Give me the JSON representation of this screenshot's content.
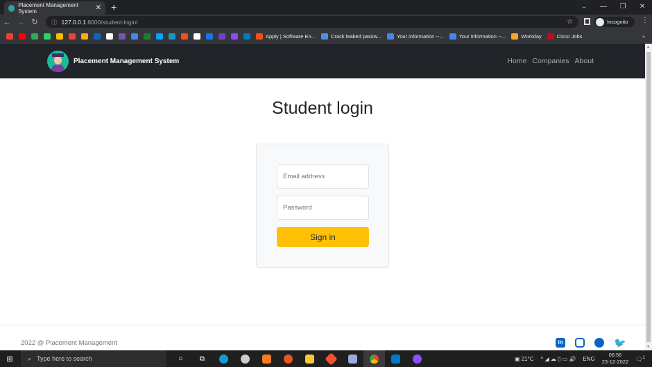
{
  "browser": {
    "tab_title": "Placement Management System",
    "url_host": "127.0.0.1",
    "url_path": ":8000/student-login/",
    "profile": "Incognito",
    "bookmarks_icons": [
      "#ea4335",
      "#ff0000",
      "#34a853",
      "#25d366",
      "#fbbc04",
      "#ea4335",
      "#f9ab00",
      "#0a66c2",
      "#ffffff",
      "#7952b3",
      "#4285f4",
      "#1e7b34",
      "#00a3ff",
      "#1798c1",
      "#f24e1e",
      "#ffffff",
      "#1a73e8",
      "#6f42c1",
      "#9146ff",
      "#0079bf"
    ],
    "bookmarks": [
      {
        "label": "Apply | Software En...",
        "color": "#f25022"
      },
      {
        "label": "Crack leaked passw...",
        "color": "#4a90e2"
      },
      {
        "label": "Your information --...",
        "color": "#4285f4"
      },
      {
        "label": "Your information --...",
        "color": "#4285f4"
      },
      {
        "label": "Workday",
        "color": "#f5a623"
      },
      {
        "label": "Cisco Jobs",
        "color": "#d0021b"
      }
    ]
  },
  "navbar": {
    "brand": "Placement Management System",
    "links": [
      "Home",
      "Companies",
      "About"
    ]
  },
  "main": {
    "title": "Student login",
    "email_placeholder": "Email address",
    "password_placeholder": "Password",
    "signin_label": "Sign in",
    "accent": "#ffc107"
  },
  "footer": {
    "copyright": "2022 @ Placement Management",
    "social": [
      "linkedin-icon",
      "instagram-icon",
      "github-icon",
      "twitter-icon"
    ]
  },
  "taskbar": {
    "search_placeholder": "Type here to search",
    "weather": "21°C",
    "language": "ENG",
    "time": "06:56",
    "date": "23-12-2022",
    "notifications": "1"
  }
}
